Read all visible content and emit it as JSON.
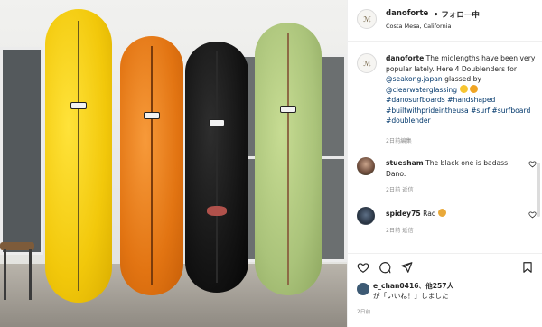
{
  "header": {
    "username": "danoforte",
    "follow_label": "• フォロー中",
    "location": "Costa Mesa, California"
  },
  "caption": {
    "username": "danoforte",
    "text": "The midlengths have been very popular lately. Here 4 Doublenders for",
    "mention1": "@seakong.japan",
    "text2": "glassed by",
    "mention2": "@clearwaterglassing",
    "hashtags": "#danosurfboards #handshaped #builtwithprideintheusa #surf #surfboard #doublender",
    "time": "2日前編集"
  },
  "comments": [
    {
      "username": "stuesham",
      "text": "The black one is badass Dano.",
      "meta": "2日前  返信"
    },
    {
      "username": "spidey75",
      "text": "Rad",
      "meta": "2日前  返信"
    }
  ],
  "likes": {
    "user": "e_chan0416",
    "count_text": "他257人",
    "suffix": "が「いいね！」しました"
  },
  "date": "2日前",
  "icons": [
    "heart-icon",
    "comment-icon",
    "share-icon",
    "bookmark-icon"
  ],
  "colors": {
    "link": "#00376b",
    "text": "#262626",
    "muted": "#8e8e8e"
  }
}
